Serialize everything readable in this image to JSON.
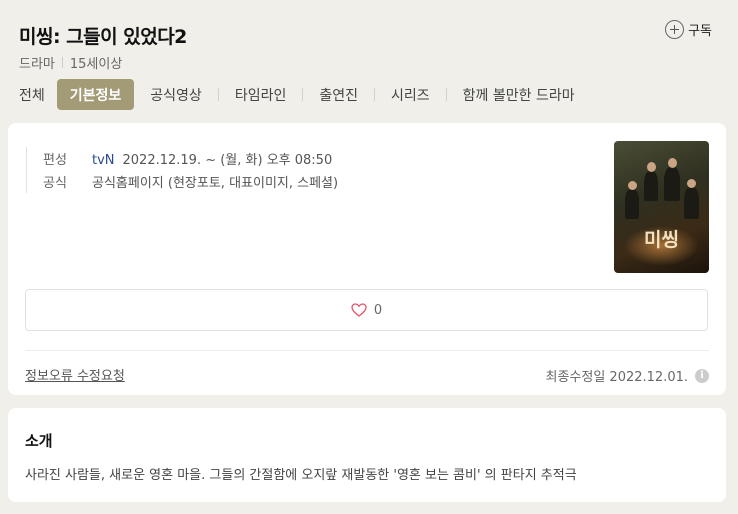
{
  "header": {
    "title": "미씽: 그들이 있었다2",
    "subscribe_label": "구독",
    "genre": "드라마",
    "rating": "15세이상"
  },
  "tabs": [
    {
      "label": "전체"
    },
    {
      "label": "기본정보",
      "active": true
    },
    {
      "label": "공식영상"
    },
    {
      "label": "타임라인"
    },
    {
      "label": "출연진"
    },
    {
      "label": "시리즈"
    },
    {
      "label": "함께 볼만한 드라마"
    }
  ],
  "info": {
    "schedule_label": "편성",
    "channel": "tvN",
    "schedule": "2022.12.19. ~ (월, 화) 오후 08:50",
    "official_label": "공식",
    "official_links": "공식홈페이지 (현장포토, 대표이미지, 스페셜)"
  },
  "poster": {
    "title": "미씽"
  },
  "likes": {
    "count": "0"
  },
  "footer": {
    "report_link": "정보오류 수정요청",
    "last_updated": "최종수정일 2022.12.01."
  },
  "intro": {
    "heading": "소개",
    "text": "사라진 사람들, 새로운 영혼 마을. 그들의 간절함에 오지랖 재발동한 '영혼 보는 콤비' 의 판타지 추적극"
  },
  "colors": {
    "background": "#f0efea",
    "tab_active": "#a39a76",
    "link": "#2c4b8f",
    "heart": "#e0566a"
  },
  "icons": [
    "plus-circle-icon",
    "heart-icon",
    "info-icon"
  ]
}
